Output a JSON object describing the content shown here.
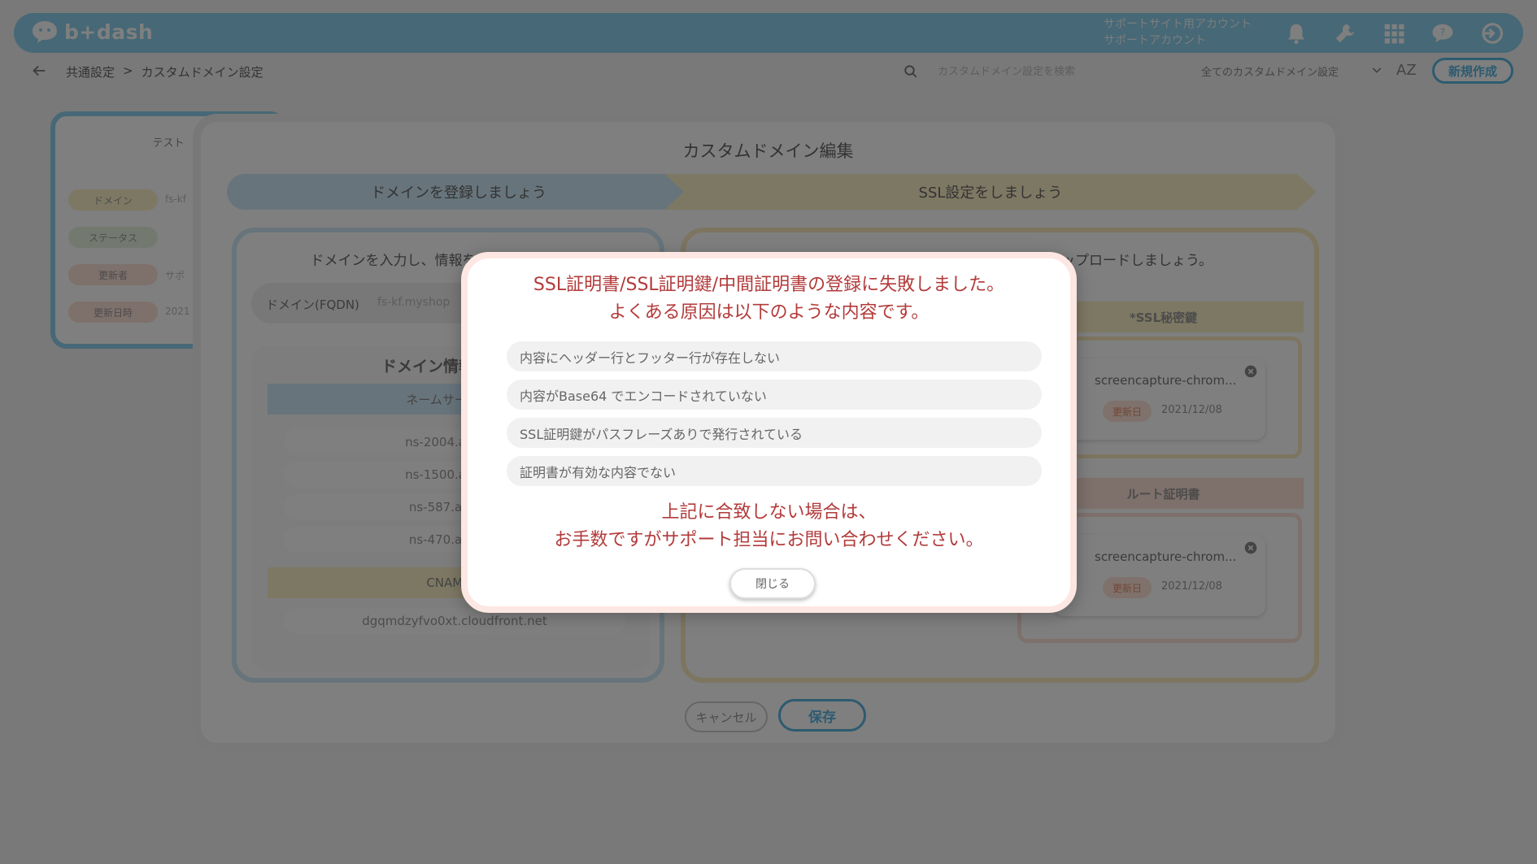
{
  "header": {
    "logo_text": "b+dash",
    "account_line1": "サポートサイト用アカウント",
    "account_line2": "サポートアカウント",
    "icons": [
      "bell-icon",
      "wrench-icon",
      "grid-icon",
      "help-chat-icon",
      "logout-icon"
    ]
  },
  "subheader": {
    "breadcrumb_root": "共通設定",
    "breadcrumb_sep": ">",
    "breadcrumb_current": "カスタムドメイン設定",
    "search_placeholder": "カスタムドメイン設定を検索",
    "filter_value": "全てのカスタムドメイン設定",
    "sort_label": "AZ",
    "new_button": "新規作成"
  },
  "bg_card": {
    "title": "テスト",
    "rows": [
      {
        "label": "ドメイン",
        "value": "fs-kf"
      },
      {
        "label": "ステータス",
        "value": ""
      },
      {
        "label": "更新者",
        "value": "サポ"
      },
      {
        "label": "更新日時",
        "value": "2021"
      }
    ]
  },
  "edit_modal": {
    "title": "カスタムドメイン編集",
    "step1": "ドメインを登録しましょう",
    "step2": "SSL設定をしましょう",
    "left": {
      "heading": "ドメインを入力し、情報を確認しましょう。",
      "domain_label": "ドメイン(FQDN)",
      "domain_value": "fs-kf.myshop",
      "info_title": "ドメイン情報",
      "nameserver_head": "ネームサーバー",
      "nameservers": [
        "ns-2004.awsdns",
        "ns-1500.awsdns",
        "ns-587.awsdns",
        "ns-470.awsdns"
      ],
      "cname_head": "CNAME",
      "cname_value": "dgqmdzyfvo0xt.cloudfront.net"
    },
    "right": {
      "heading": "ドメインをSSL化するための、ファイルをアップロードしましょう。",
      "ssl_key_head": "*SSL秘密鍵",
      "root_cert_head": "ルート証明書",
      "file_name": "screencapture-chrom...",
      "file_badge": "更新日",
      "file_date": "2021/12/08"
    },
    "cancel": "キャンセル",
    "save": "保存"
  },
  "error_dialog": {
    "line1": "SSL証明書/SSL証明鍵/中間証明書の登録に失敗しました。",
    "line2": "よくある原因は以下のような内容です。",
    "reasons": [
      "内容にヘッダー行とフッター行が存在しない",
      "内容がBase64 でエンコードされていない",
      "SSL証明鍵がパスフレーズありで発行されている",
      "証明書が有効な内容でない"
    ],
    "footer1": "上記に合致しない場合は、",
    "footer2": "お手数ですがサポート担当にお問い合わせください。",
    "close": "閉じる"
  },
  "colors": {
    "brand_blue": "#8ed0ec",
    "accent_blue": "#5bb6e0",
    "error_red": "#b33a3a",
    "step2_yellow": "#fbf1c7"
  }
}
